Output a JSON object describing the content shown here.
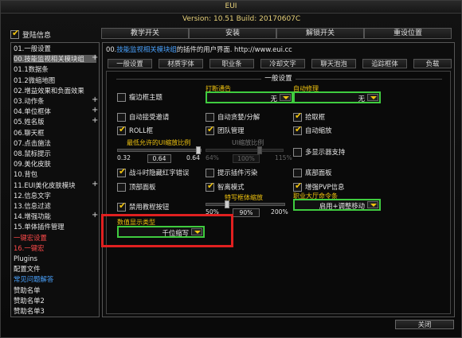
{
  "window": {
    "title": "EUI",
    "version": "Version: 10.51 Build: 20170607C"
  },
  "login": {
    "label": "登陆信息",
    "checked": true
  },
  "top_buttons": [
    "教学开关",
    "安装",
    "解锁开关",
    "重设位置"
  ],
  "sidebar": {
    "items": [
      {
        "label": "01.一般设置",
        "state": "normal",
        "plus": false
      },
      {
        "label": "00.技能监视相关模块组",
        "state": "selected",
        "plus": true
      },
      {
        "label": "01.1数据条",
        "state": "normal",
        "plus": false
      },
      {
        "label": "01.2微缩地图",
        "state": "normal",
        "plus": false
      },
      {
        "label": "02.增益效果和负面效果",
        "state": "normal",
        "plus": false
      },
      {
        "label": "03.动作条",
        "state": "normal",
        "plus": true
      },
      {
        "label": "04.单位框体",
        "state": "normal",
        "plus": true
      },
      {
        "label": "05.姓名版",
        "state": "normal",
        "plus": true
      },
      {
        "label": "06.聊天框",
        "state": "normal",
        "plus": false
      },
      {
        "label": "07.点击施法",
        "state": "normal",
        "plus": false
      },
      {
        "label": "08.鼠标提示",
        "state": "normal",
        "plus": false
      },
      {
        "label": "09.美化皮肤",
        "state": "normal",
        "plus": false
      },
      {
        "label": "10.背包",
        "state": "normal",
        "plus": false
      },
      {
        "label": "11.EUI美化皮肤模块",
        "state": "normal",
        "plus": true
      },
      {
        "label": "12.信息文字",
        "state": "normal",
        "plus": false
      },
      {
        "label": "13.信息过滤",
        "state": "normal",
        "plus": false
      },
      {
        "label": "14.增强功能",
        "state": "normal",
        "plus": true
      },
      {
        "label": "15.单体插件管理",
        "state": "normal",
        "plus": false
      },
      {
        "label": "一键宏设置",
        "state": "red",
        "plus": false
      },
      {
        "label": "16.一键宏",
        "state": "red",
        "plus": false
      },
      {
        "label": "Plugins",
        "state": "normal",
        "plus": false
      },
      {
        "label": "配置文件",
        "state": "normal",
        "plus": false
      },
      {
        "label": "常见问题解答",
        "state": "blue",
        "plus": false
      },
      {
        "label": "赞助名单",
        "state": "normal",
        "plus": false
      },
      {
        "label": "赞助名单2",
        "state": "normal",
        "plus": false
      },
      {
        "label": "赞助名单3",
        "state": "normal",
        "plus": false
      }
    ]
  },
  "main": {
    "header_prefix": "00.",
    "header_highlight": "技能监视相关模块组",
    "header_suffix": "的插件的用户界面. http://www.eui.cc",
    "tabs": [
      "一般设置",
      "材质字体",
      "职业条",
      "冷却文字",
      "聊天泡泡",
      "追踪框体",
      "负载"
    ],
    "section_title": "一般设置",
    "checkboxes": {
      "thin_border": {
        "label": "瘦边框主题",
        "checked": false
      },
      "auto_invite": {
        "label": "自动接受邀请",
        "checked": false
      },
      "auto_roll": {
        "label": "自动贪婪/分解",
        "checked": false
      },
      "loot_frame": {
        "label": "拾取框",
        "checked": true
      },
      "roll_frame": {
        "label": "ROLL框",
        "checked": true
      },
      "team_manage": {
        "label": "团队管理",
        "checked": true
      },
      "auto_scale": {
        "label": "自动缩放",
        "checked": true
      },
      "multi_monitor": {
        "label": "多显示器支持",
        "checked": false
      },
      "hide_error": {
        "label": "战斗时隐藏红字错误",
        "checked": true
      },
      "show_plugin_err": {
        "label": "提示插件污染",
        "checked": false
      },
      "bottom_panel": {
        "label": "底部面板",
        "checked": false
      },
      "top_panel": {
        "label": "顶部面板",
        "checked": false
      },
      "smart_mode": {
        "label": "智离模式",
        "checked": true
      },
      "enhance_pvp": {
        "label": "增强PVP信息",
        "checked": true
      },
      "disable_tutorial": {
        "label": "禁用教程按钮",
        "checked": true
      }
    },
    "dropdowns": {
      "repair_notice": {
        "label": "打断通告",
        "value": "无"
      },
      "auto_repair": {
        "label": "自动修理",
        "value": "无"
      },
      "class_hall": {
        "label": "职业大厅命令条",
        "value": "启用+调整移动"
      },
      "number_type": {
        "label": "数值显示类型",
        "value": "千位缩写"
      }
    },
    "min_ui_scale": {
      "label": "最低允许的UI缩放比例",
      "value": "0.64",
      "min_label": "0.32",
      "max_label": "0.64",
      "fill": 1.0
    },
    "ui_scale": {
      "label": "UI缩放比例",
      "value": "100%",
      "min_label": "64%",
      "max_label": "115%",
      "fill": 0.7
    },
    "special_scale": {
      "label": "特写框体缩放",
      "value": "90%",
      "min_label": "50%",
      "max_label": "200%",
      "fill": 0.27
    }
  },
  "close_label": "关闭"
}
